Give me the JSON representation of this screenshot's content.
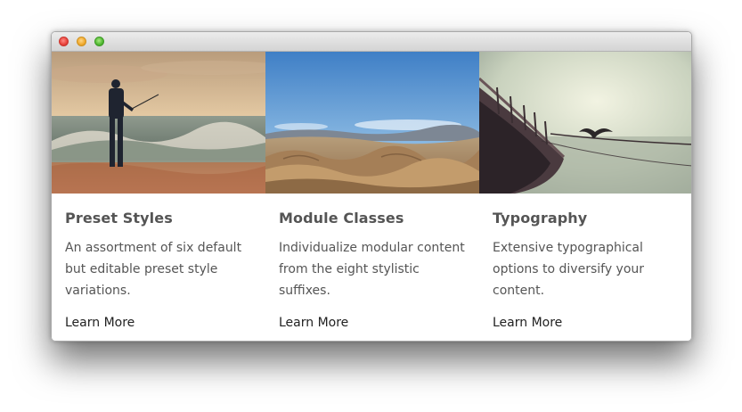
{
  "window": {
    "controls": [
      "close",
      "minimize",
      "zoom"
    ]
  },
  "cards": [
    {
      "title": "Preset Styles",
      "text": "An assortment of six default but editable preset style variations.",
      "link": "Learn More"
    },
    {
      "title": "Module Classes",
      "text": "Individualize modular content from the eight stylistic suffixes.",
      "link": "Learn More"
    },
    {
      "title": "Typography",
      "text": "Extensive typographical options to diversify your content.",
      "link": "Learn More"
    }
  ],
  "colors": {
    "title": "#555555",
    "body_text": "#555555",
    "link": "#222222",
    "background": "#ffffff"
  }
}
